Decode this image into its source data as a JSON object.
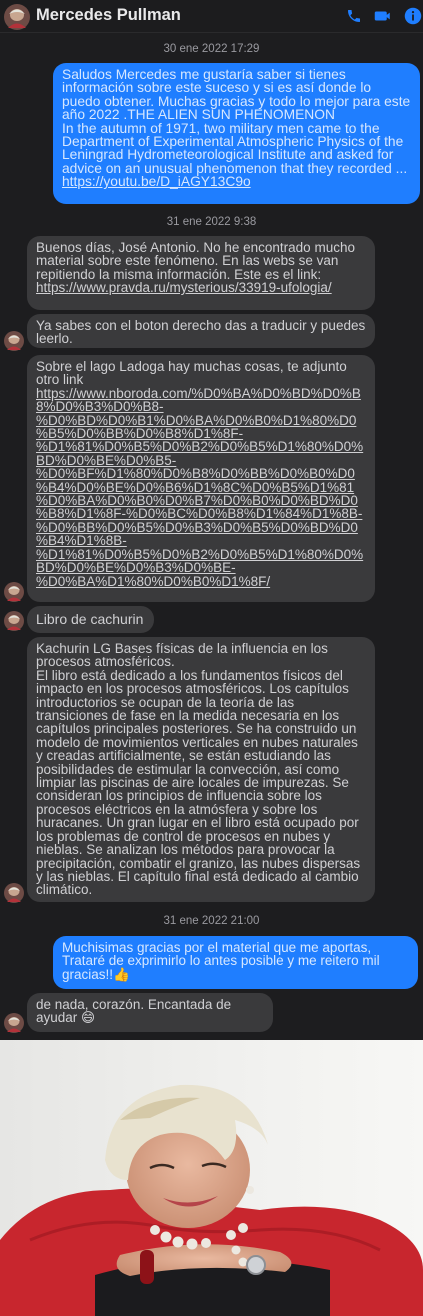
{
  "header": {
    "contact_name": "Mercedes Pullman",
    "icons": [
      "phone-icon",
      "video-camera-icon",
      "info-icon"
    ],
    "accent_color": "#1f7eff"
  },
  "messages": [
    {
      "type": "timestamp",
      "text": "30 ene 2022 17:29"
    },
    {
      "type": "outgoing",
      "text": "Saludos Mercedes me gustaría saber si tienes información sobre este suceso y si es así donde lo puedo obtener. Muchas gracias y todo lo mejor para este año 2022 .THE ALIEN SUN PHENOMENON\nIn the autumn of 1971, two military men came to the Department of Experimental Atmospheric Physics of the Leningrad Hydrometeorological Institute and asked for advice on an unusual phenomenon that they recorded ...",
      "link": "https://youtu.be/D_iAGY13C9o"
    },
    {
      "type": "timestamp",
      "text": "31 ene 2022 9:38"
    },
    {
      "type": "incoming",
      "text": "Buenos días, José Antonio. No he encontrado mucho material sobre este fenómeno. En las webs se van repitiendo la misma información. Este es el link: ",
      "link": "https://www.pravda.ru/mysterious/33919-ufologia/"
    },
    {
      "type": "incoming",
      "text": "Ya sabes con el boton derecho das a traducir y puedes leerlo."
    },
    {
      "type": "incoming",
      "text": "Sobre el lago Ladoga hay muchas cosas, te adjunto otro link",
      "link": "https://www.nboroda.com/%D0%BA%D0%BD%D0%B8%D0%B3%D0%B8-%D0%BD%D0%B1%D0%BA%D0%B0%D1%80%D0%B5%D0%BB%D0%B8%D1%8F-%D1%81%D0%B5%D0%B2%D0%B5%D1%80%D0%BD%D0%BE%D0%B5-%D0%BF%D1%80%D0%B8%D0%BB%D0%B0%D0%B4%D0%BE%D0%B6%D1%8C%D0%B5%D1%81%D0%BA%D0%B0%D0%B7%D0%B0%D0%BD%D0%B8%D1%8F-%D0%BC%D0%B8%D1%84%D1%8B-%D0%BB%D0%B5%D0%B3%D0%B5%D0%BD%D0%B4%D1%8B-%D1%81%D0%B5%D0%B2%D0%B5%D1%80%D0%BD%D0%BE%D0%B3%D0%BE-%D0%BA%D1%80%D0%B0%D1%8F/"
    },
    {
      "type": "incoming",
      "text": "Libro de cachurin"
    },
    {
      "type": "incoming",
      "text": "Kachurin LG Bases físicas de la influencia en los procesos atmosféricos.\nEl libro está dedicado a los fundamentos físicos del impacto en los procesos atmosféricos. Los capítulos introductorios se ocupan de la teoría de las transiciones de fase en la medida necesaria en los capítulos principales posteriores. Se ha construido un modelo de movimientos verticales en nubes naturales y creadas artificialmente, se están estudiando las posibilidades de estimular la convección, así como limpiar las piscinas de aire locales de impurezas. Se consideran los principios de influencia sobre los procesos eléctricos en la atmósfera y sobre los huracanes. Un gran lugar en el libro está ocupado por los problemas de control de procesos en nubes y nieblas. Se analizan los métodos para provocar la precipitación, combatir el granizo, las nubes dispersas y las nieblas. El capítulo final está dedicado al cambio climático."
    },
    {
      "type": "timestamp",
      "text": "31 ene 2022 21:00"
    },
    {
      "type": "outgoing",
      "text": "Muchisimas gracias por el material que me aportas, Trataré de exprimirlo lo antes posible y me reitero mil gracias!!👍"
    },
    {
      "type": "incoming",
      "text": "de nada, corazón. Encantada de ayudar 😄"
    }
  ],
  "photo": {
    "description_icon": "profile-photo"
  }
}
